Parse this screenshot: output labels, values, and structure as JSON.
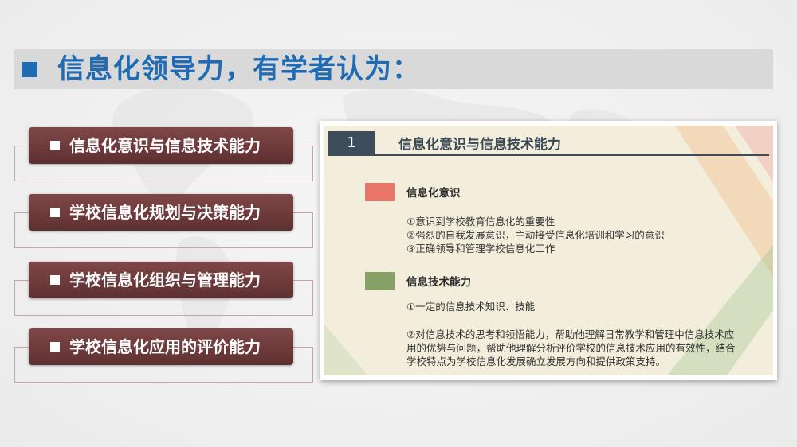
{
  "title": "信息化领导力，有学者认为：",
  "menu": [
    {
      "label": "信息化意识与信息技术能力"
    },
    {
      "label": "学校信息化规划与决策能力"
    },
    {
      "label": "学校信息化组织与管理能力"
    },
    {
      "label": "学校信息化应用的评价能力"
    }
  ],
  "card": {
    "number": "1",
    "heading": "信息化意识与信息技术能力",
    "sections": [
      {
        "label": "信息化意识",
        "lines": [
          "①意识到学校教育信息化的重要性",
          "②强烈的自我发展意识，主动接受信息化培训和学习的意识",
          "③正确领导和管理学校信息化工作"
        ]
      },
      {
        "label": "信息技术能力",
        "lines": [
          "①一定的信息技术知识、技能",
          "②对信息技术的思考和领悟能力，帮助他理解日常教学和管理中信息技术应",
          "用的优势与问题，帮助他理解分析评价学校的信息技术应用的有效性，结合",
          "学校特点为学校信息化发展确立发展方向和提供政策支持。"
        ]
      }
    ]
  },
  "colors": {
    "blue": "#1f6cb5",
    "maroon": "#6e3a3b",
    "slate": "#3e4d5c",
    "red": "#ea7569",
    "green": "#87a067"
  }
}
